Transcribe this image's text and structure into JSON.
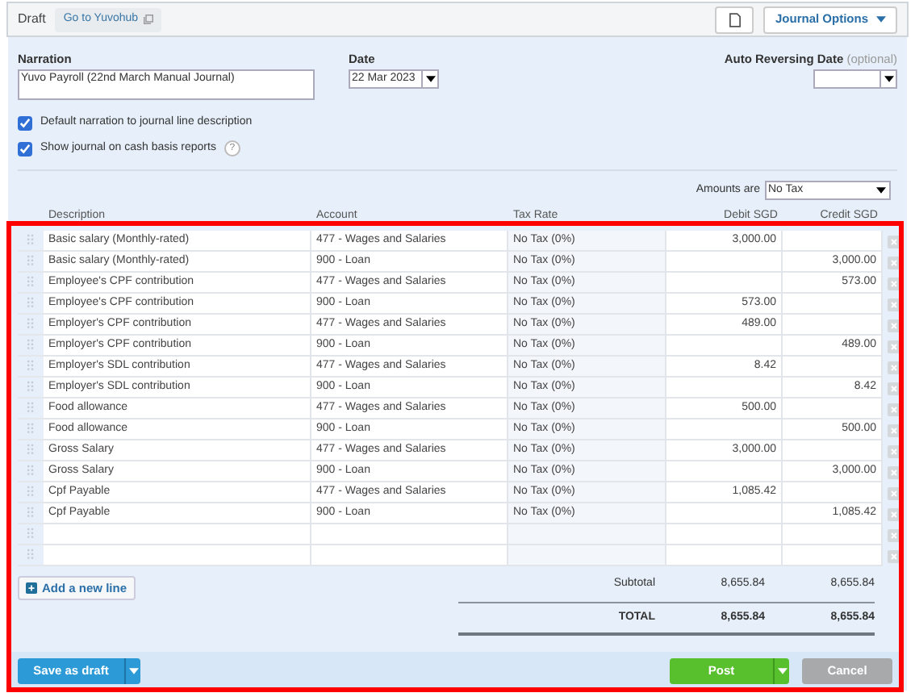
{
  "header": {
    "status": "Draft",
    "link": "Go to Yuvohub",
    "options_button": "Journal Options"
  },
  "narration": {
    "label": "Narration",
    "value": "Yuvo Payroll (22nd March Manual Journal)"
  },
  "date": {
    "label": "Date",
    "value": "22 Mar 2023"
  },
  "auto_reversing": {
    "label": "Auto Reversing Date",
    "hint": "(optional)"
  },
  "options": [
    {
      "label": "Default narration to journal line description",
      "checked": true
    },
    {
      "label": "Show journal on cash basis reports",
      "checked": true,
      "help": "?"
    }
  ],
  "amounts_are": {
    "label": "Amounts are",
    "value": "No Tax"
  },
  "table": {
    "columns": [
      "Description",
      "Account",
      "Tax Rate",
      "Debit SGD",
      "Credit SGD"
    ],
    "rows": [
      {
        "kind": "line",
        "description": "Basic salary (Monthly-rated)",
        "account": "477 - Wages and Salaries",
        "tax_rate": "No Tax (0%)",
        "debit": "3,000.00"
      },
      {
        "kind": "line",
        "description": "Basic salary (Monthly-rated)",
        "account": "900 - Loan",
        "tax_rate": "No Tax (0%)",
        "credit": "3,000.00"
      },
      {
        "kind": "line",
        "description": "Employee's CPF contribution",
        "account": "477 - Wages and Salaries",
        "tax_rate": "No Tax (0%)",
        "credit": "573.00"
      },
      {
        "kind": "line",
        "description": "Employee's CPF contribution",
        "account": "900 - Loan",
        "tax_rate": "No Tax (0%)",
        "debit": "573.00"
      },
      {
        "kind": "line",
        "description": "Employer's CPF contribution",
        "account": "477 - Wages and Salaries",
        "tax_rate": "No Tax (0%)",
        "debit": "489.00"
      },
      {
        "kind": "line",
        "description": "Employer's CPF contribution",
        "account": "900 - Loan",
        "tax_rate": "No Tax (0%)",
        "credit": "489.00"
      },
      {
        "kind": "line",
        "description": "Employer's SDL contribution",
        "account": "477 - Wages and Salaries",
        "tax_rate": "No Tax (0%)",
        "debit": "8.42"
      },
      {
        "kind": "line",
        "description": "Employer's SDL contribution",
        "account": "900 - Loan",
        "tax_rate": "No Tax (0%)",
        "credit": "8.42"
      },
      {
        "kind": "line",
        "description": "Food allowance",
        "account": "477 - Wages and Salaries",
        "tax_rate": "No Tax (0%)",
        "debit": "500.00"
      },
      {
        "kind": "line",
        "description": "Food allowance",
        "account": "900 - Loan",
        "tax_rate": "No Tax (0%)",
        "credit": "500.00"
      },
      {
        "kind": "line",
        "description": "Gross Salary",
        "account": "477 - Wages and Salaries",
        "tax_rate": "No Tax (0%)",
        "debit": "3,000.00"
      },
      {
        "kind": "line",
        "description": "Gross Salary",
        "account": "900 - Loan",
        "tax_rate": "No Tax (0%)",
        "credit": "3,000.00"
      },
      {
        "kind": "line",
        "description": "Cpf Payable",
        "account": "477 - Wages and Salaries",
        "tax_rate": "No Tax (0%)",
        "debit": "1,085.42"
      },
      {
        "kind": "line",
        "description": "Cpf Payable",
        "account": "900 - Loan",
        "tax_rate": "No Tax (0%)",
        "credit": "1,085.42"
      },
      {
        "kind": "blank"
      },
      {
        "kind": "blank"
      }
    ]
  },
  "add_line": "Add a new line",
  "subtotal": {
    "label": "Subtotal",
    "debit": "8,655.84",
    "credit": "8,655.84"
  },
  "total": {
    "label": "TOTAL",
    "debit": "8,655.84",
    "credit": "8,655.84"
  },
  "footer": {
    "save": "Save as draft",
    "post": "Post",
    "cancel": "Cancel"
  }
}
